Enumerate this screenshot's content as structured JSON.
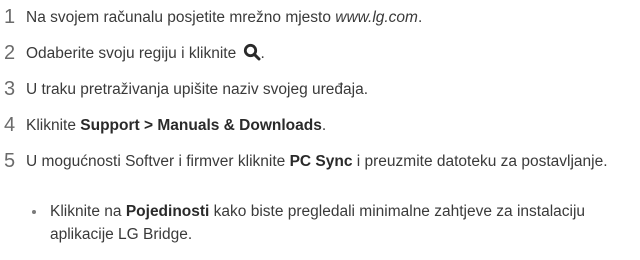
{
  "steps": [
    {
      "number": "1",
      "before": "Na svojem računalu posjetite mrežno mjesto ",
      "italic": "www.lg.com",
      "after": "."
    },
    {
      "number": "2",
      "before": "Odaberite svoju regiju i kliknite ",
      "icon": "search-icon",
      "after": "."
    },
    {
      "number": "3",
      "text": "U traku pretraživanja upišite naziv svojeg uređaja."
    },
    {
      "number": "4",
      "before": "Kliknite ",
      "bold": "Support > Manuals & Downloads",
      "after": "."
    },
    {
      "number": "5",
      "before": "U mogućnosti Softver i firmver kliknite ",
      "bold": "PC Sync",
      "after": " i preuzmite datoteku za postavljanje."
    }
  ],
  "bullet": {
    "before": "Kliknite na ",
    "bold": "Pojedinosti",
    "after": " kako biste pregledali minimalne zahtjeve za instalaciju aplikacije LG Bridge."
  }
}
